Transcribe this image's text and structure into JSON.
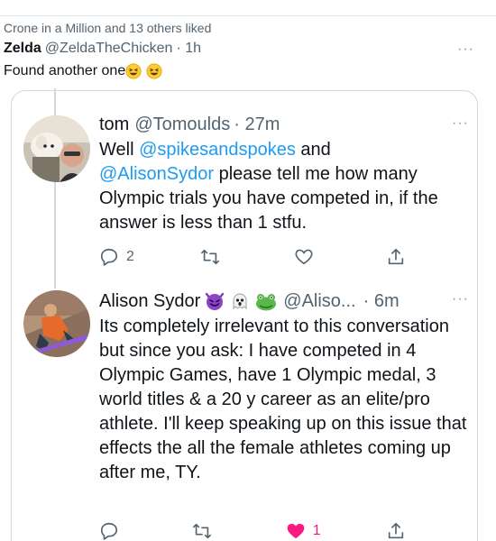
{
  "retweet_context": "Crone in a Million and 13 others liked",
  "tweet": {
    "name": "Zelda",
    "handle": "@ZeldaTheChicken",
    "time": "· 1h",
    "text": "Found another one",
    "more": "···"
  },
  "replies": [
    {
      "name": "tom",
      "handle": "@Tomoulds",
      "time": "· 27m",
      "text_prefix": "Well ",
      "mention1": "@spikesandspokes",
      "text_mid": " and ",
      "mention2": "@AlisonSydor",
      "text_suffix": " please tell me how many Olympic trials you have competed in, if the answer is less than 1 stfu.",
      "reply_count": "2",
      "retweet_count": "",
      "like_count": "",
      "more": "···"
    },
    {
      "name": "Alison Sydor",
      "handle": "@Aliso...",
      "time": "· 6m",
      "text": "Its completely irrelevant to this conversation but since you ask: I have competed in 4 Olympic Games, have 1 Olympic medal, 3 world titles & a 20 y career as an elite/pro athlete. I'll keep speaking up on this issue that effects the all the female athletes coming up after me, TY.",
      "reply_count": "",
      "retweet_count": "",
      "like_count": "1",
      "more": "···"
    }
  ],
  "icons": [
    "reply-icon",
    "retweet-icon",
    "like-icon",
    "share-icon",
    "more-icon",
    "grinning-squinting-emoji",
    "devil-emoji",
    "ghost-emoji",
    "frog-emoji"
  ],
  "colors": {
    "link": "#1d9bf0",
    "like": "#f91880",
    "muted": "#536471"
  }
}
